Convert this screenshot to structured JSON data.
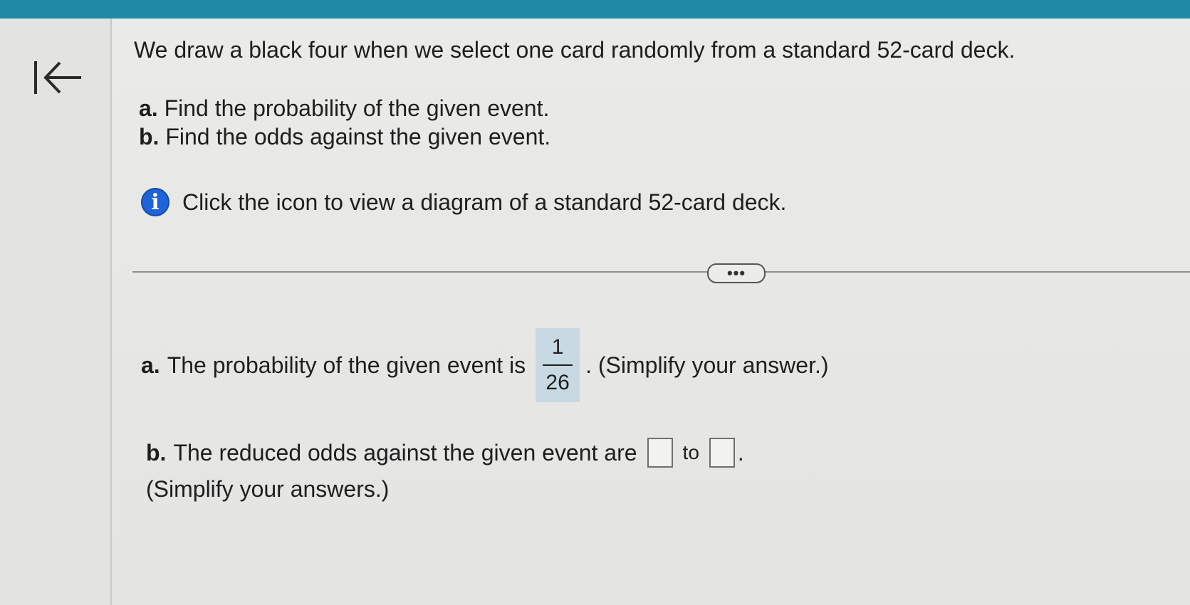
{
  "header": {
    "accent_color": "#1f8aa4"
  },
  "nav": {
    "back_icon": "arrow-left-to-bar-icon"
  },
  "question": {
    "prompt": "We draw a black four when we select one card randomly from a standard 52-card deck.",
    "parts": [
      {
        "letter": "a.",
        "text": "Find the probability of the given event."
      },
      {
        "letter": "b.",
        "text": "Find the odds against the given event."
      }
    ],
    "info_icon": "info-icon",
    "info_text": "Click the icon to view a diagram of a standard 52-card deck."
  },
  "divider": {
    "more_label": "•••"
  },
  "answers": {
    "a": {
      "letter": "a.",
      "prefix": "The probability of the given event is",
      "numerator": "1",
      "denominator": "26",
      "suffix": ". (Simplify your answer.)",
      "box_color": "#c9d9e3"
    },
    "b": {
      "letter": "b.",
      "prefix": "The reduced odds against the given event are",
      "first_value": "",
      "to_word": "to",
      "second_value": "",
      "period": ".",
      "note": "(Simplify your answers.)"
    }
  }
}
